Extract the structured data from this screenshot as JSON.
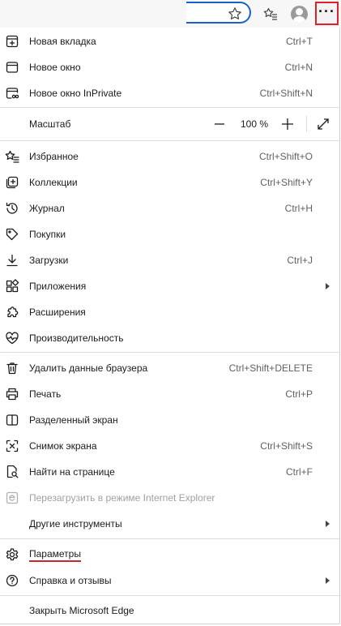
{
  "menu": {
    "items": [
      {
        "label": "Новая вкладка",
        "shortcut": "Ctrl+T",
        "icon": "new-tab-icon"
      },
      {
        "label": "Новое окно",
        "shortcut": "Ctrl+N",
        "icon": "new-window-icon"
      },
      {
        "label": "Новое окно InPrivate",
        "shortcut": "Ctrl+Shift+N",
        "icon": "inprivate-icon"
      },
      {
        "label": "Масштаб",
        "zoom": "100 %"
      },
      {
        "label": "Избранное",
        "shortcut": "Ctrl+Shift+O",
        "icon": "favorites-icon"
      },
      {
        "label": "Коллекции",
        "shortcut": "Ctrl+Shift+Y",
        "icon": "collections-icon"
      },
      {
        "label": "Журнал",
        "shortcut": "Ctrl+H",
        "icon": "history-icon"
      },
      {
        "label": "Покупки",
        "shortcut": "",
        "icon": "shopping-tag-icon"
      },
      {
        "label": "Загрузки",
        "shortcut": "Ctrl+J",
        "icon": "download-icon"
      },
      {
        "label": "Приложения",
        "shortcut": "",
        "icon": "apps-icon"
      },
      {
        "label": "Расширения",
        "shortcut": "",
        "icon": "extensions-icon"
      },
      {
        "label": "Производительность",
        "shortcut": "",
        "icon": "performance-icon"
      },
      {
        "label": "Удалить данные браузера",
        "shortcut": "Ctrl+Shift+DELETE",
        "icon": "trash-icon"
      },
      {
        "label": "Печать",
        "shortcut": "Ctrl+P",
        "icon": "printer-icon"
      },
      {
        "label": "Разделенный экран",
        "shortcut": "",
        "icon": "split-screen-icon"
      },
      {
        "label": "Снимок экрана",
        "shortcut": "Ctrl+Shift+S",
        "icon": "screenshot-icon"
      },
      {
        "label": "Найти на странице",
        "shortcut": "Ctrl+F",
        "icon": "find-icon"
      },
      {
        "label": "Перезагрузить в режиме Internet Explorer",
        "shortcut": "",
        "icon": "ie-mode-icon"
      },
      {
        "label": "Другие инструменты",
        "shortcut": ""
      },
      {
        "label": "Параметры",
        "shortcut": "",
        "icon": "gear-icon"
      },
      {
        "label": "Справка и отзывы",
        "shortcut": "",
        "icon": "help-icon"
      },
      {
        "label": "Закрыть Microsoft Edge",
        "shortcut": ""
      }
    ]
  },
  "colors": {
    "highlight": "#e0202a",
    "address_border": "#1a5fd0"
  }
}
